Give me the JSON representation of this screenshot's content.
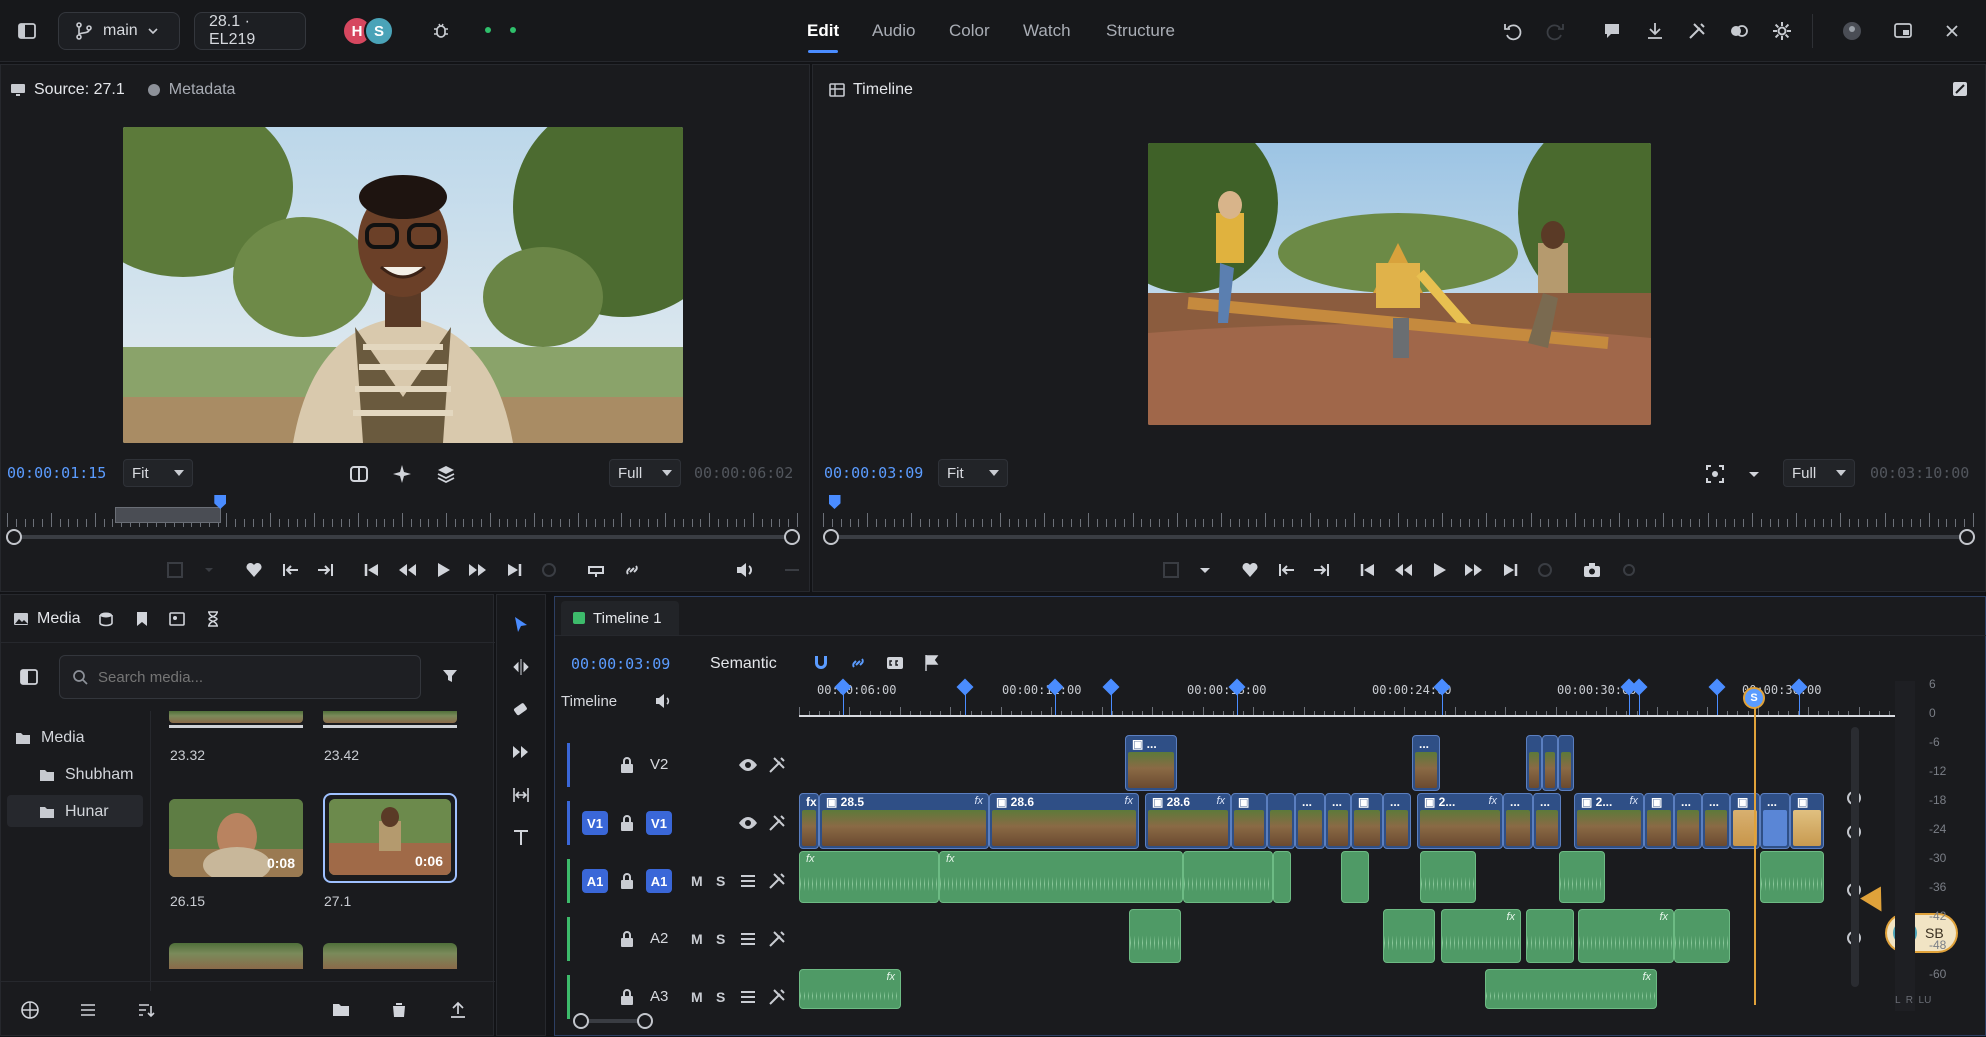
{
  "topbar": {
    "branch": "main",
    "version": "28.1 · EL219",
    "avatars": [
      "H",
      "S"
    ],
    "tabs": [
      {
        "label": "Edit",
        "active": true
      },
      {
        "label": "Audio",
        "active": false
      },
      {
        "label": "Color",
        "active": false
      },
      {
        "label": "Watch",
        "active": false
      },
      {
        "label": "Structure",
        "active": false
      }
    ],
    "accent": "#4a8cff"
  },
  "source_viewer": {
    "title": "Source: 27.1",
    "metadata_label": "Metadata",
    "timecode": "00:00:01:15",
    "fit": "Fit",
    "quality": "Full",
    "duration": "00:00:06:02",
    "playhead_fraction": 0.27
  },
  "program_viewer": {
    "title": "Timeline",
    "timecode": "00:00:03:09",
    "fit": "Fit",
    "quality": "Full",
    "duration": "00:03:10:00",
    "playhead_fraction": 0.01
  },
  "media": {
    "title": "Media",
    "search_placeholder": "Search media...",
    "tree": [
      {
        "label": "Media",
        "level": 0
      },
      {
        "label": "Shubham",
        "level": 1
      },
      {
        "label": "Hunar",
        "level": 1,
        "selected": true
      }
    ],
    "clips": [
      {
        "name": "23.32",
        "duration": ""
      },
      {
        "name": "23.42",
        "duration": ""
      },
      {
        "name": "26.15",
        "duration": "0:08"
      },
      {
        "name": "27.1",
        "duration": "0:06",
        "selected": true
      }
    ]
  },
  "timeline": {
    "tab_label": "Timeline 1",
    "timecode": "00:00:03:09",
    "mode": "Semantic",
    "track_area_label": "Timeline",
    "ruler": [
      "00:00:06:00",
      "00:00:12:00",
      "00:00:18:00",
      "00:00:24:00",
      "00:00:30:00",
      "00:00:36:00"
    ],
    "tracks": {
      "v2": "V2",
      "v1": "V1",
      "a1": "A1",
      "a2": "A2",
      "a3": "A3",
      "mute": "M",
      "solo": "S"
    },
    "clip_labels": [
      "28.5",
      "28.6",
      "28.6",
      "2...",
      "2..."
    ],
    "meter_scale": [
      "6",
      "0",
      "-6",
      "-12",
      "-18",
      "-24",
      "-30",
      "-36",
      "-42",
      "-48",
      "-60"
    ],
    "meter_footer": "L  R  LU",
    "collaborator": {
      "initial": "S",
      "name": "SB"
    }
  }
}
